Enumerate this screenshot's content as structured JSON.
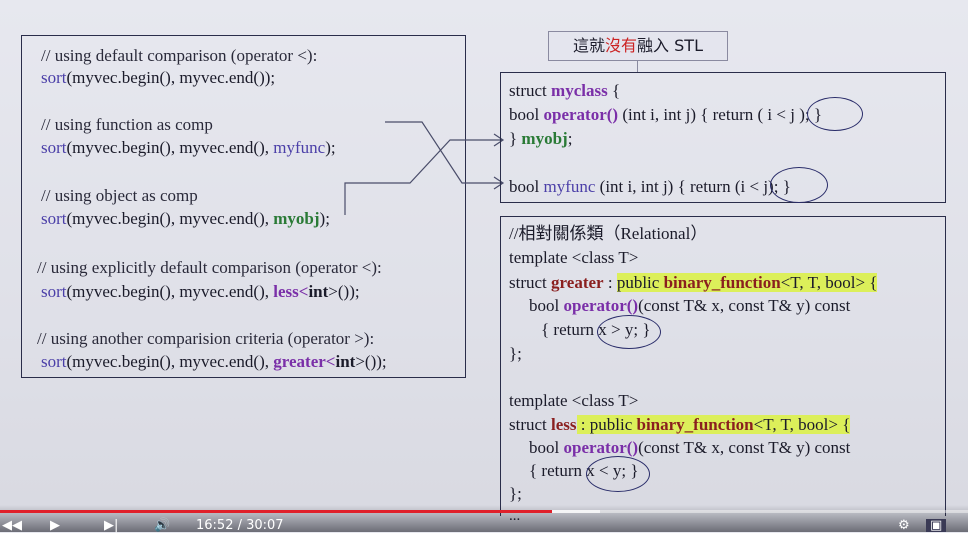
{
  "left_code": {
    "lines": [
      [
        "// using default comparison (operator <):"
      ],
      [
        "sort",
        "(myvec.begin(), myvec.end());"
      ],
      [
        "// using function as comp"
      ],
      [
        "sort",
        "(myvec.begin(), myvec.end(), ",
        "myfunc",
        ");"
      ],
      [
        "// using object as comp"
      ],
      [
        "sort",
        "(myvec.begin(), myvec.end(), ",
        "myobj",
        ");"
      ],
      [
        "// using explicitly default comparison (operator <):"
      ],
      [
        "sort",
        "(myvec.begin(), myvec.end(), ",
        "less",
        "<",
        "int",
        ">());"
      ],
      [
        "// using another comparision criteria (operator >):"
      ],
      [
        "sort",
        "(myvec.begin(), myvec.end(), ",
        "greater",
        "<",
        "int",
        ">());"
      ]
    ]
  },
  "label": {
    "prefix": "這就",
    "highlight": "沒有",
    "suffix": "融入 STL"
  },
  "right_top": {
    "l1": [
      "struct ",
      "myclass",
      "  {"
    ],
    "l2": [
      "  bool ",
      "operator()",
      " (int i, int j) { return ",
      "( i < j",
      " ); }"
    ],
    "l3": [
      "} ",
      "myobj",
      ";"
    ],
    "l4": [
      "bool ",
      "myfunc",
      " (int i, int j) { return ",
      "(i < j);",
      " }"
    ]
  },
  "right_bottom": {
    "lines": {
      "c1": "//相對關係類（Relational）",
      "t1": "template <class T>",
      "s1a": "struct ",
      "s1b": "greater",
      "s1c": " : ",
      "s1d": "public ",
      "s1e": "binary_function",
      "s1f": "<T, T, bool> {",
      "o1a": "bool ",
      "o1b": "operator()",
      "o1c": "(const T& x, const T& y) const",
      "r1a": "{ return ",
      "r1b": "x > y;",
      "r1c": " }",
      "e1": "};",
      "t2": "template <class T>",
      "s2a": "struct ",
      "s2b": "less",
      "s2c": " : public ",
      "s2e": "binary_function",
      "s2f": "<T, T, bool> {",
      "o2a": "bool ",
      "o2b": "operator()",
      "o2c": "(const T& x, const T& y) const",
      "r2a": "{ return ",
      "r2b": "x < y;",
      "r2c": " }",
      "e2": "};",
      "dots": "..."
    }
  },
  "player": {
    "progress_fraction": 0.57,
    "buffer_fraction": 0.62,
    "time": "16:52 / 30:07"
  },
  "colors": {
    "accent": "#e0202a",
    "highlight": "#dcef5a",
    "border": "#2a2d4a"
  }
}
